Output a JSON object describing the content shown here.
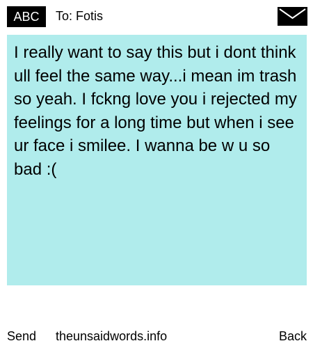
{
  "header": {
    "mode_label": "ABC",
    "recipient": "To: Fotis",
    "envelope_icon": "envelope-icon"
  },
  "message": {
    "text": "I really want to say this but i dont think ull feel the same way...i mean im trash so yeah. I fckng love you i rejected my feelings for a long time but when i see ur face i smilee. I wanna be w u so bad :("
  },
  "footer": {
    "send_label": "Send",
    "site_label": "theunsaidwords.info",
    "back_label": "Back"
  },
  "colors": {
    "message_background": "#b0ecec",
    "badge_background": "#000000",
    "badge_text": "#ffffff"
  }
}
